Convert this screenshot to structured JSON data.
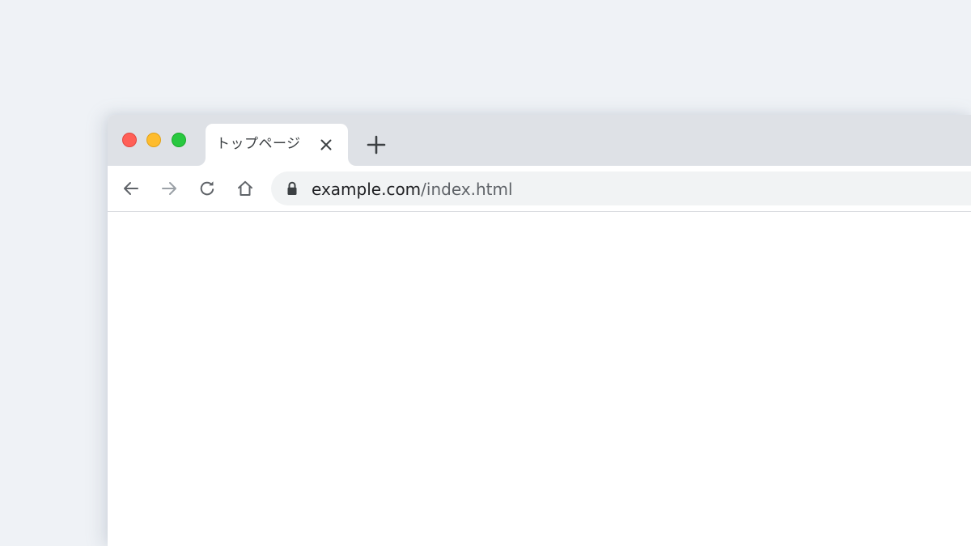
{
  "tab": {
    "title": "トップページ"
  },
  "address_bar": {
    "url_domain": "example.com",
    "url_path": "/index.html"
  },
  "icons": {
    "window_close": "traffic-light-red",
    "window_minimize": "traffic-light-yellow",
    "window_zoom": "traffic-light-green",
    "tab_close": "close-icon",
    "new_tab": "plus-icon",
    "back": "arrow-left-icon",
    "forward": "arrow-right-icon",
    "reload": "reload-icon",
    "home": "home-icon",
    "secure": "lock-icon"
  },
  "colors": {
    "desktop_background": "#eff2f6",
    "tab_strip": "#dee1e6",
    "active_tab": "#ffffff",
    "omnibox": "#f1f3f4",
    "traffic_close": "#ff5f57",
    "traffic_minimize": "#febc2e",
    "traffic_zoom": "#28c840",
    "forward_disabled": "#9aa0a6",
    "icon": "#5f6368"
  },
  "state": {
    "forward_enabled": false
  }
}
